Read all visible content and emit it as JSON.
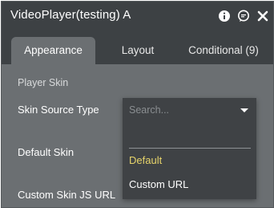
{
  "window": {
    "title": "VideoPlayer(testing) A",
    "icons": [
      "info-icon",
      "comment-icon",
      "close-icon"
    ]
  },
  "tabs": [
    {
      "label": "Appearance",
      "active": true
    },
    {
      "label": "Layout",
      "active": false
    },
    {
      "label": "Conditional (9)",
      "active": false
    }
  ],
  "section": {
    "title": "Player Skin"
  },
  "properties": {
    "skin_source_type": "Skin Source Type",
    "default_skin": "Default Skin",
    "custom_skin_js_url": "Custom Skin JS URL"
  },
  "dropdown": {
    "search_placeholder": "Search...",
    "search_value": "",
    "options": [
      {
        "label": "Default",
        "selected": true
      },
      {
        "label": "Custom URL",
        "selected": false
      }
    ]
  },
  "colors": {
    "titlebar_bg": "#3d4144",
    "panel_bg": "#6b6f72",
    "dropdown_bg": "#3f4245",
    "selected_option": "#e6d36a"
  }
}
